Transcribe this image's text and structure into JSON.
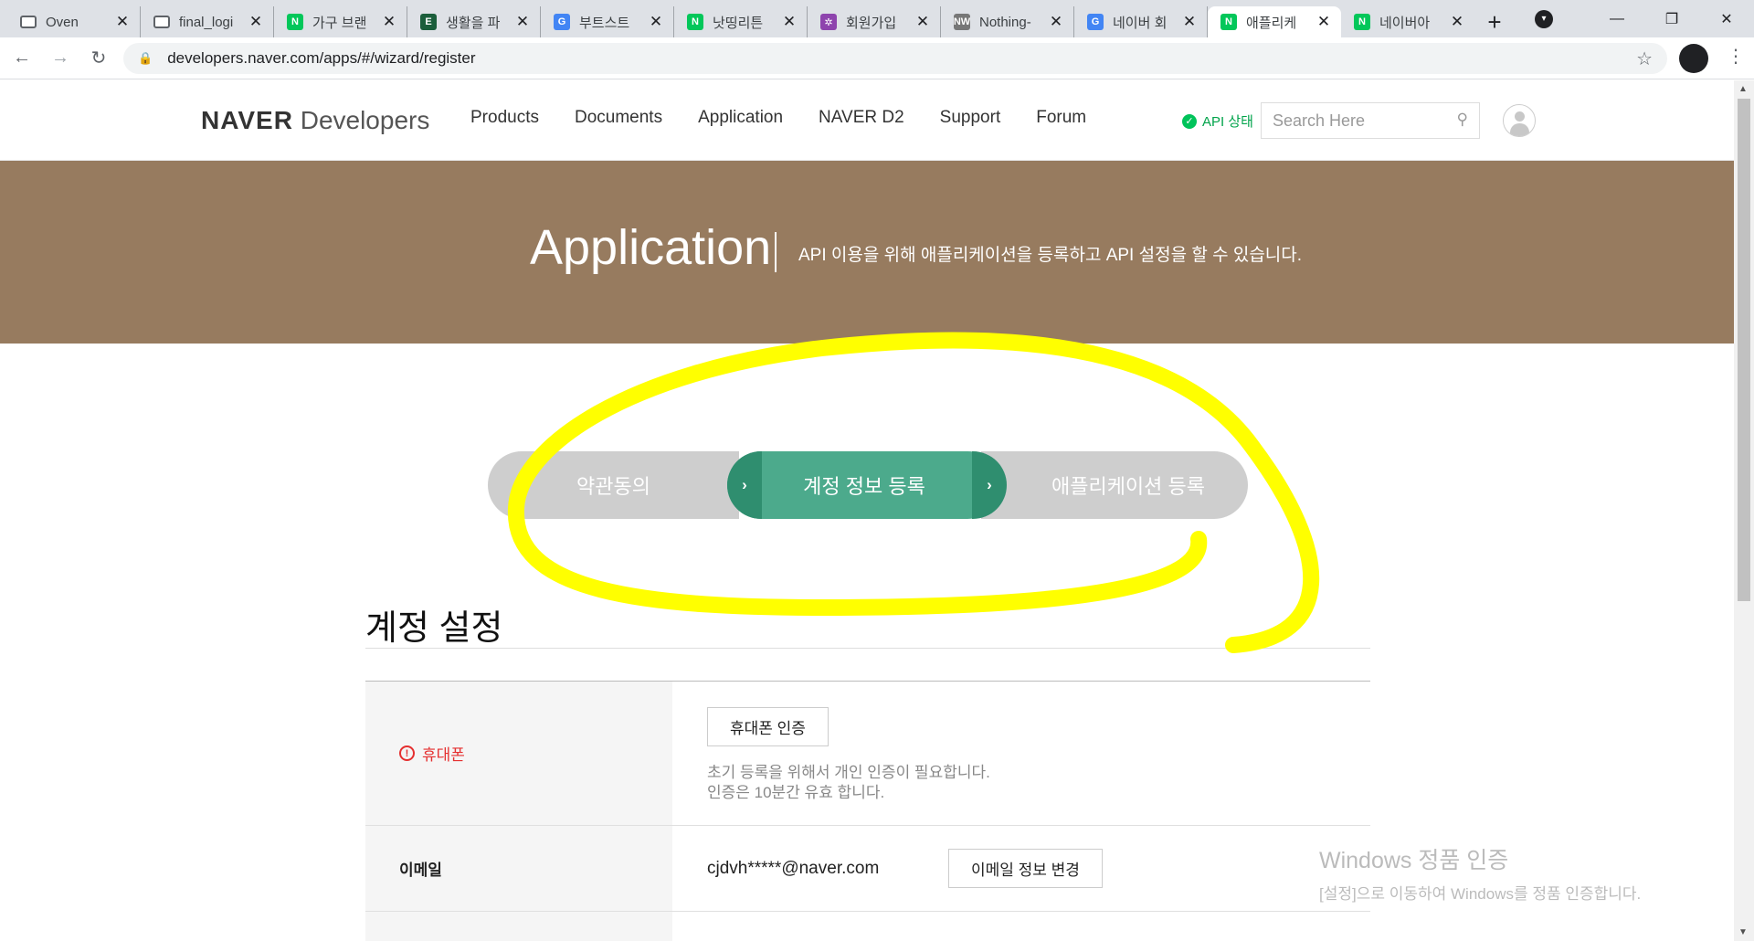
{
  "browser": {
    "tabs": [
      {
        "title": "Oven",
        "favicon": "window-icon",
        "color": "#5f6368",
        "active": false
      },
      {
        "title": "final_logi",
        "favicon": "window-icon",
        "color": "#5f6368",
        "active": false
      },
      {
        "title": "가구 브랜",
        "favicon": "N",
        "color": "#03c75a",
        "active": false
      },
      {
        "title": "생활을 파",
        "favicon": "E",
        "color": "#1b5e3b",
        "active": false
      },
      {
        "title": "부트스트",
        "favicon": "G",
        "color": "#4285f4",
        "active": false
      },
      {
        "title": "낫띵리튼",
        "favicon": "N",
        "color": "#03c75a",
        "active": false
      },
      {
        "title": "회원가입",
        "favicon": "✲",
        "color": "#8e44ad",
        "active": false
      },
      {
        "title": "Nothing-",
        "favicon": "NW",
        "color": "#777777",
        "active": false
      },
      {
        "title": "네이버 회",
        "favicon": "G",
        "color": "#4285f4",
        "active": false
      },
      {
        "title": "애플리케",
        "favicon": "N",
        "color": "#03c75a",
        "active": true
      },
      {
        "title": "네이버아",
        "favicon": "N",
        "color": "#03c75a",
        "active": false
      }
    ],
    "url": "developers.naver.com/apps/#/wizard/register"
  },
  "gnb": {
    "logo_bold": "NAVER",
    "logo_light": " Developers",
    "menu": [
      "Products",
      "Documents",
      "Application",
      "NAVER D2",
      "Support",
      "Forum"
    ],
    "api_status": "API 상태",
    "search_placeholder": "Search Here"
  },
  "banner": {
    "title": "Application",
    "description": "API 이용을 위해 애플리케이션을 등록하고 API 설정을 할 수 있습니다.",
    "background": "#977b5f"
  },
  "steps": {
    "items": [
      "약관동의",
      "계정 정보 등록",
      "애플리케이션 등록"
    ],
    "active_index": 1,
    "active_color": "#4caa8c",
    "inactive_color": "#cecece"
  },
  "section": {
    "title": "계정 설정"
  },
  "form": {
    "phone": {
      "label": "휴대폰",
      "button": "휴대폰 인증",
      "help_line1": "초기 등록을 위해서 개인 인증이 필요합니다.",
      "help_line2": "인증은 10분간 유효 합니다."
    },
    "email": {
      "label": "이메일",
      "value": "cjdvh*****@naver.com",
      "button": "이메일 정보 변경"
    }
  },
  "watermark": {
    "line1": "Windows 정품 인증",
    "line2": "[설정]으로 이동하여 Windows를 정품 인증합니다."
  },
  "annotation_color": "#ffff00"
}
